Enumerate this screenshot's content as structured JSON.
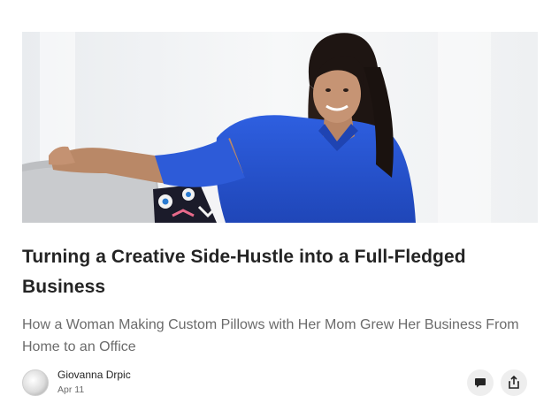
{
  "article": {
    "image_alt": "Woman in a blue blouse sitting on a grey sofa next to a patterned pillow",
    "title": "Turning a Creative Side-Hustle into a Full-Fledged Business",
    "subtitle": "How a Woman Making Custom Pillows with Her Mom Grew Her Business From Home to an Office",
    "author": "Giovanna Drpic",
    "date": "Apr 11"
  },
  "actions": {
    "comment_icon": "comment-icon",
    "share_icon": "share-icon"
  },
  "colors": {
    "title": "#242424",
    "subtitle": "#6b6b6b",
    "button_bg": "#eeeeee"
  }
}
